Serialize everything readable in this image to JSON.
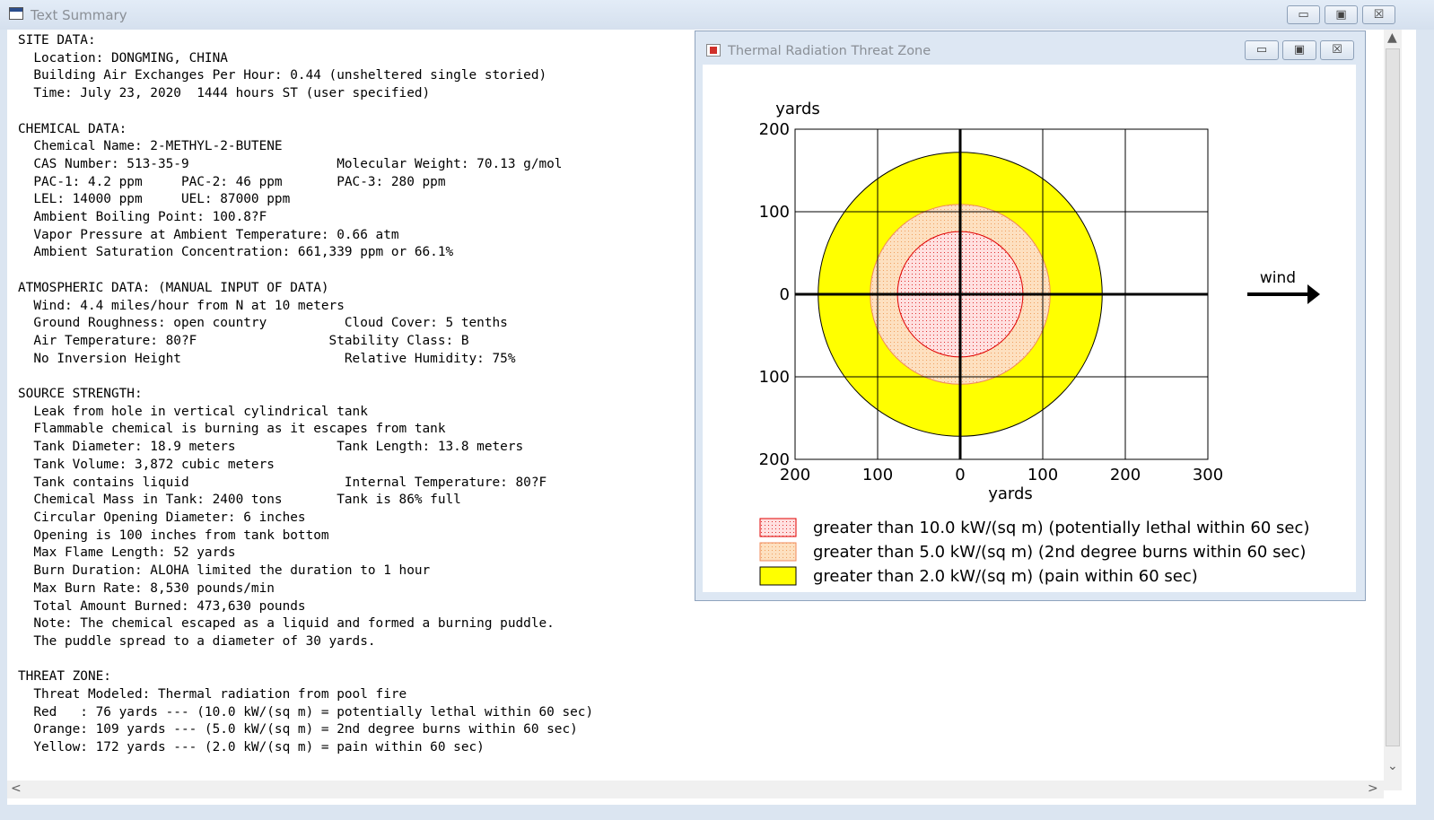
{
  "main_window": {
    "title": "Text Summary",
    "buttons": {
      "minimize": "▭",
      "maximize": "▣",
      "close": "☒"
    }
  },
  "report": {
    "lines": [
      "SITE DATA:",
      "  Location: DONGMING, CHINA",
      "  Building Air Exchanges Per Hour: 0.44 (unsheltered single storied)",
      "  Time: July 23, 2020  1444 hours ST (user specified)",
      "",
      "CHEMICAL DATA:",
      "  Chemical Name: 2-METHYL-2-BUTENE",
      "  CAS Number: 513-35-9                   Molecular Weight: 70.13 g/mol",
      "  PAC-1: 4.2 ppm     PAC-2: 46 ppm       PAC-3: 280 ppm",
      "  LEL: 14000 ppm     UEL: 87000 ppm",
      "  Ambient Boiling Point: 100.8?F",
      "  Vapor Pressure at Ambient Temperature: 0.66 atm",
      "  Ambient Saturation Concentration: 661,339 ppm or 66.1%",
      "",
      "ATMOSPHERIC DATA: (MANUAL INPUT OF DATA)",
      "  Wind: 4.4 miles/hour from N at 10 meters",
      "  Ground Roughness: open country          Cloud Cover: 5 tenths",
      "  Air Temperature: 80?F                 Stability Class: B",
      "  No Inversion Height                     Relative Humidity: 75%",
      "",
      "SOURCE STRENGTH:",
      "  Leak from hole in vertical cylindrical tank",
      "  Flammable chemical is burning as it escapes from tank",
      "  Tank Diameter: 18.9 meters             Tank Length: 13.8 meters",
      "  Tank Volume: 3,872 cubic meters",
      "  Tank contains liquid                    Internal Temperature: 80?F",
      "  Chemical Mass in Tank: 2400 tons       Tank is 86% full",
      "  Circular Opening Diameter: 6 inches",
      "  Opening is 100 inches from tank bottom",
      "  Max Flame Length: 52 yards",
      "  Burn Duration: ALOHA limited the duration to 1 hour",
      "  Max Burn Rate: 8,530 pounds/min",
      "  Total Amount Burned: 473,630 pounds",
      "  Note: The chemical escaped as a liquid and formed a burning puddle.",
      "  The puddle spread to a diameter of 30 yards.",
      "",
      "THREAT ZONE:",
      "  Threat Modeled: Thermal radiation from pool fire",
      "  Red   : 76 yards --- (10.0 kW/(sq m) = potentially lethal within 60 sec)",
      "  Orange: 109 yards --- (5.0 kW/(sq m) = 2nd degree burns within 60 sec)",
      "  Yellow: 172 yards --- (2.0 kW/(sq m) = pain within 60 sec)"
    ]
  },
  "scrollbar": {
    "up": "▲",
    "down": "⌄",
    "left": "<",
    "right": ">"
  },
  "threat_window": {
    "title": "Thermal Radiation Threat Zone",
    "buttons": {
      "minimize": "▭",
      "maximize": "▣",
      "close": "☒"
    }
  },
  "chart_data": {
    "type": "threat-zone",
    "xlabel": "yards",
    "ylabel": "yards",
    "x_ticks": [
      "200",
      "100",
      "0",
      "100",
      "200",
      "300"
    ],
    "y_ticks": [
      "200",
      "100",
      "0",
      "100",
      "200"
    ],
    "xlim": [
      -200,
      300
    ],
    "ylim": [
      -200,
      200
    ],
    "grid": true,
    "wind_label": "wind",
    "zones": [
      {
        "name": "red",
        "radius_yards": 76,
        "fill": "#ffe0e0",
        "dot_color": "#e03030",
        "stroke": "#e00000",
        "legend": "greater than 10.0 kW/(sq m) (potentially lethal within 60 sec)"
      },
      {
        "name": "orange",
        "radius_yards": 109,
        "fill": "#fde0c0",
        "dot_color": "#f0a060",
        "stroke": "#f08a5a",
        "legend": "greater than 5.0 kW/(sq m) (2nd degree burns within 60 sec)"
      },
      {
        "name": "yellow",
        "radius_yards": 172,
        "fill": "#ffff00",
        "dot_color": "",
        "stroke": "#000000",
        "legend": "greater than 2.0 kW/(sq m) (pain within 60 sec)"
      }
    ]
  }
}
